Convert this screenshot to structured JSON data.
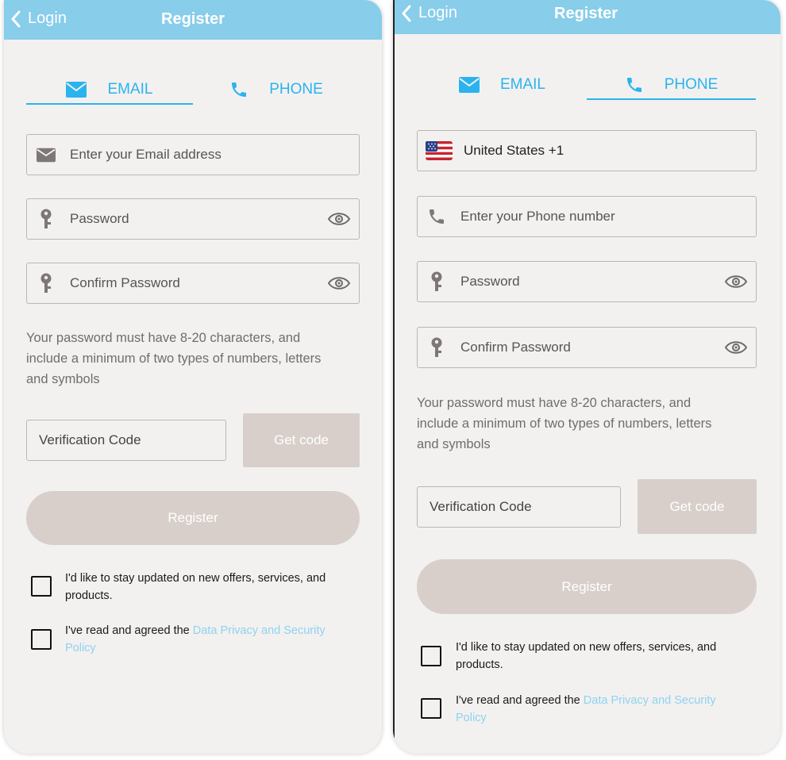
{
  "header": {
    "back_label": "Login",
    "title": "Register"
  },
  "tabs": {
    "email_label": "EMAIL",
    "phone_label": "PHONE"
  },
  "fields": {
    "email_placeholder": "Enter your Email address",
    "password_placeholder": "Password",
    "confirm_placeholder": "Confirm Password",
    "country_value": "United States +1",
    "phone_placeholder": "Enter your Phone number",
    "verification_placeholder": "Verification Code"
  },
  "hint": {
    "line1": "Your password must have 8-20 characters, and",
    "line2": "include a minimum of two types of numbers, letters",
    "line3": "and symbols"
  },
  "buttons": {
    "get_code": "Get code",
    "register": "Register"
  },
  "consent": {
    "offers_line1": "I'd like to stay updated on new offers, services, and",
    "offers_line2": "products.",
    "privacy_prefix": "I've read and agreed the ",
    "privacy_link_line1": "Data Privacy and Security",
    "privacy_link_line2": "Policy"
  },
  "colors": {
    "header": "#88cdea",
    "accent": "#2bb3ef",
    "button_disabled": "#d8cfca",
    "link": "#8fd2f0"
  },
  "icons": [
    "chevron-left-icon",
    "mail-icon",
    "phone-icon",
    "key-icon",
    "eye-icon",
    "us-flag-icon"
  ]
}
